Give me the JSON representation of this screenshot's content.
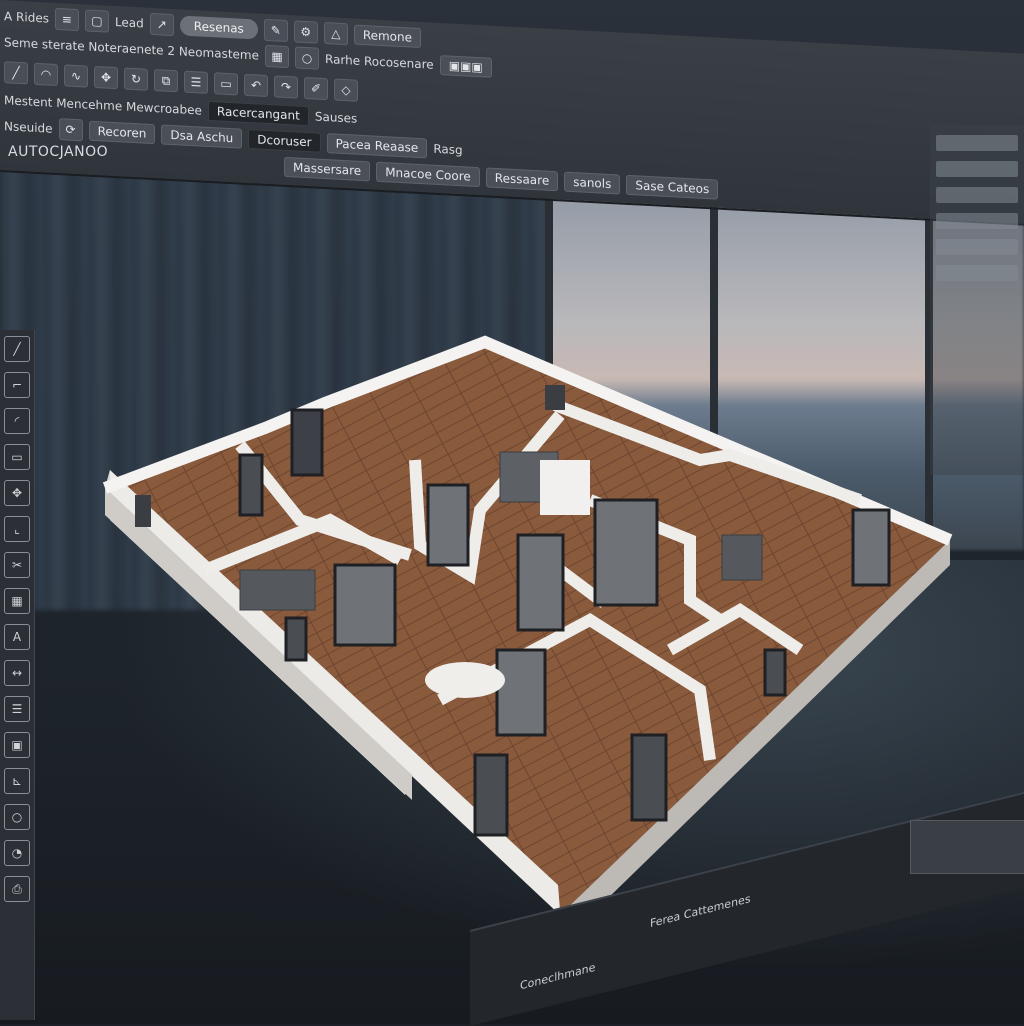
{
  "toolbar": {
    "row1": {
      "app_menu": "A Rides",
      "lead_label": "Lead",
      "search_pill": "Resenas",
      "dropdown": "Remone"
    },
    "row2": {
      "breadcrumb": "Seme sterate Noteraenete 2 Neomasteme",
      "field": "Rarhe Rocosenare"
    },
    "row4": {
      "left_label": "Mestent Mencehme Mewcroabee",
      "ribbon_label": "Racercangant",
      "right_label": "Sauses"
    },
    "row5": {
      "left_label": "Nseuide",
      "btn1": "Recoren",
      "btn2": "Dsa Aschu",
      "dark_btn": "Dcoruser",
      "right_btn": "Pacea Reaase",
      "side": "Rasg"
    },
    "row6": {
      "btn1": "Massersare",
      "btn2": "Mnacoe Coore",
      "btn3": "Ressaare",
      "field": "sanols",
      "right_btn": "Sase Cateos"
    }
  },
  "brand": "AUTOCJANOO",
  "status_bar": {
    "left": "Coneclhmane",
    "right": "Ferea Cattemenes"
  },
  "icons": [
    "line-icon",
    "arc-icon",
    "curve-icon",
    "move-icon",
    "rotate-icon",
    "copy-icon",
    "layer-icon",
    "block-icon",
    "undo-icon",
    "redo-icon",
    "draw-icon",
    "shape-icon"
  ]
}
